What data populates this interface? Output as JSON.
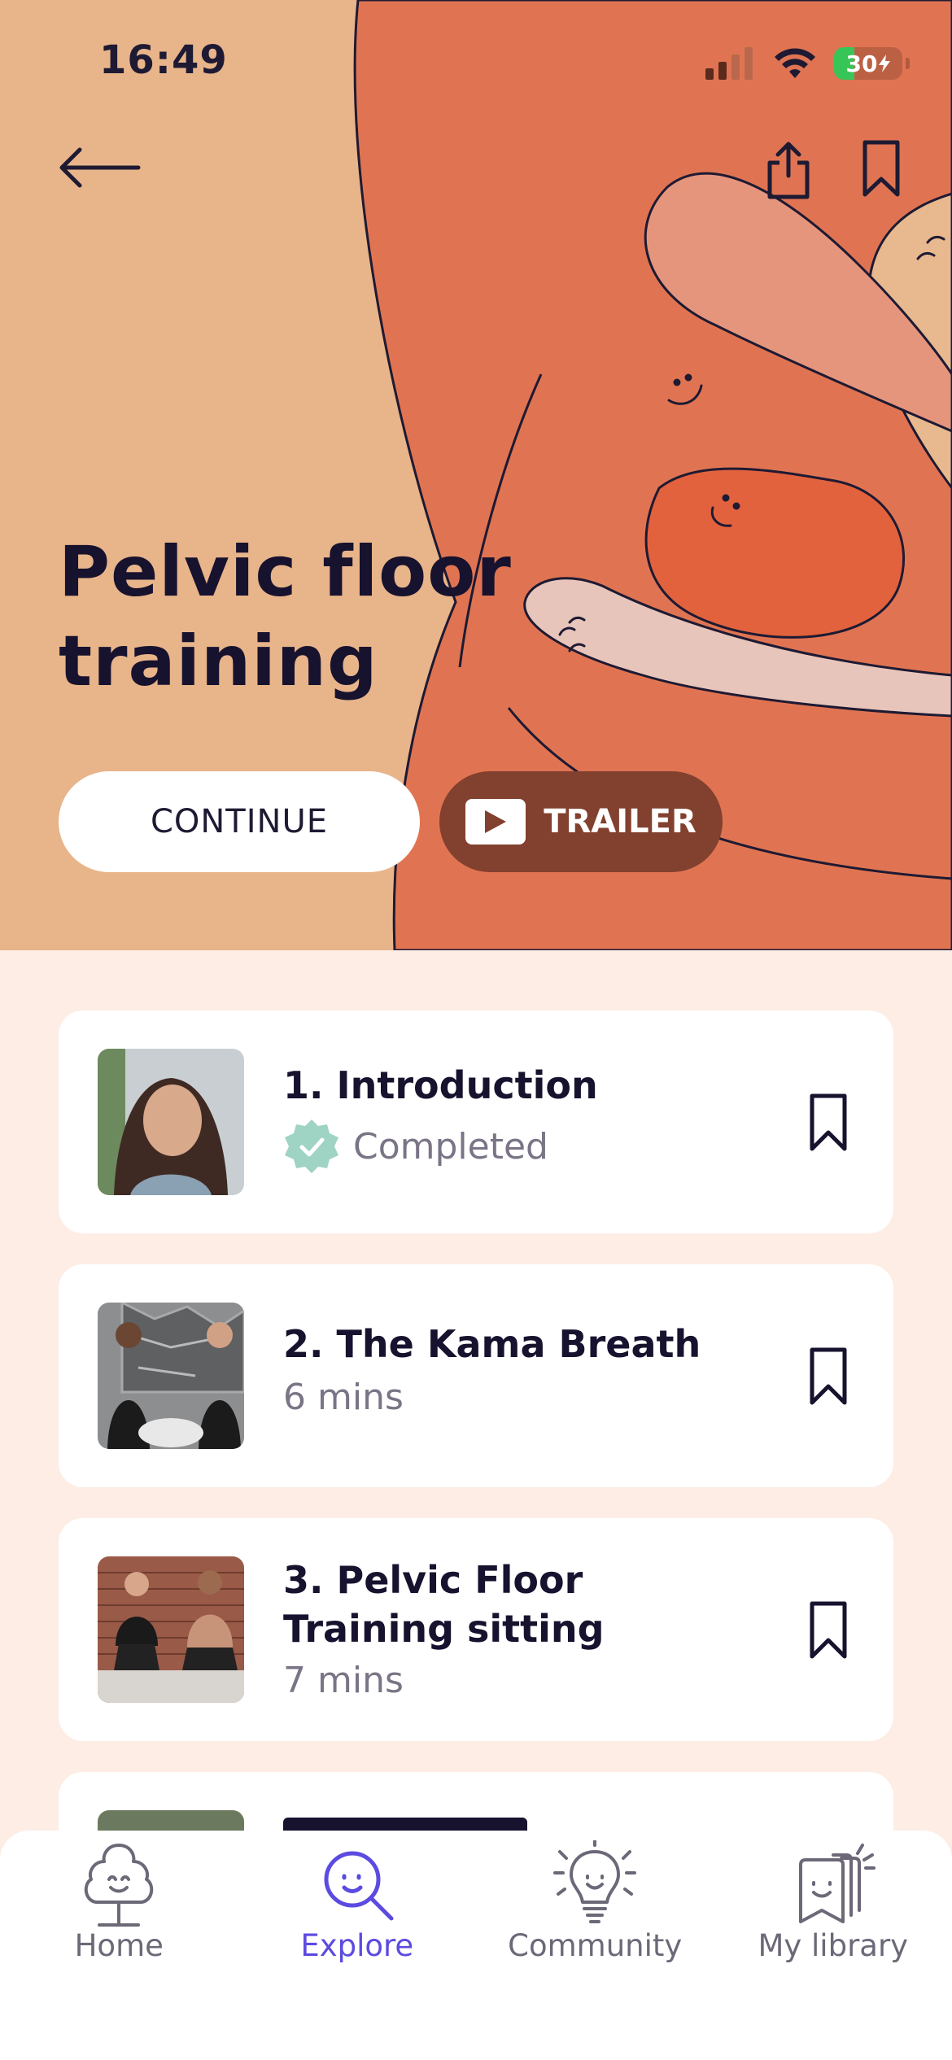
{
  "status_bar": {
    "time": "16:49",
    "battery": "30"
  },
  "header": {
    "title_line1": "Pelvic floor",
    "title_line2": "training"
  },
  "actions": {
    "continue_label": "CONTINUE",
    "trailer_label": "TRAILER"
  },
  "lessons": [
    {
      "title": "1. Introduction",
      "status": "Completed"
    },
    {
      "title": "2. The Kama Breath",
      "duration": "6 mins"
    },
    {
      "title_line1": "3. Pelvic Floor",
      "title_line2": "Training sitting",
      "duration": "7 mins"
    }
  ],
  "tabbar": {
    "items": [
      {
        "label": "Home"
      },
      {
        "label": "Explore"
      },
      {
        "label": "Community"
      },
      {
        "label": "My library"
      }
    ],
    "active": "Explore"
  },
  "colors": {
    "hero_background": "#E8B48A",
    "hero_accent": "#E07452",
    "page_background": "#FDEDE5",
    "active_tab": "#5B4BE0",
    "completed_badge": "#9FD3C3",
    "trailer_button": "#82402F"
  },
  "icons": {
    "back": "arrow-left-icon",
    "share": "share-icon",
    "save": "bookmark-icon",
    "play": "play-icon",
    "completed": "check-badge-icon",
    "tabs": [
      "tree-icon",
      "search-face-icon",
      "lightbulb-icon",
      "library-cards-icon"
    ]
  }
}
